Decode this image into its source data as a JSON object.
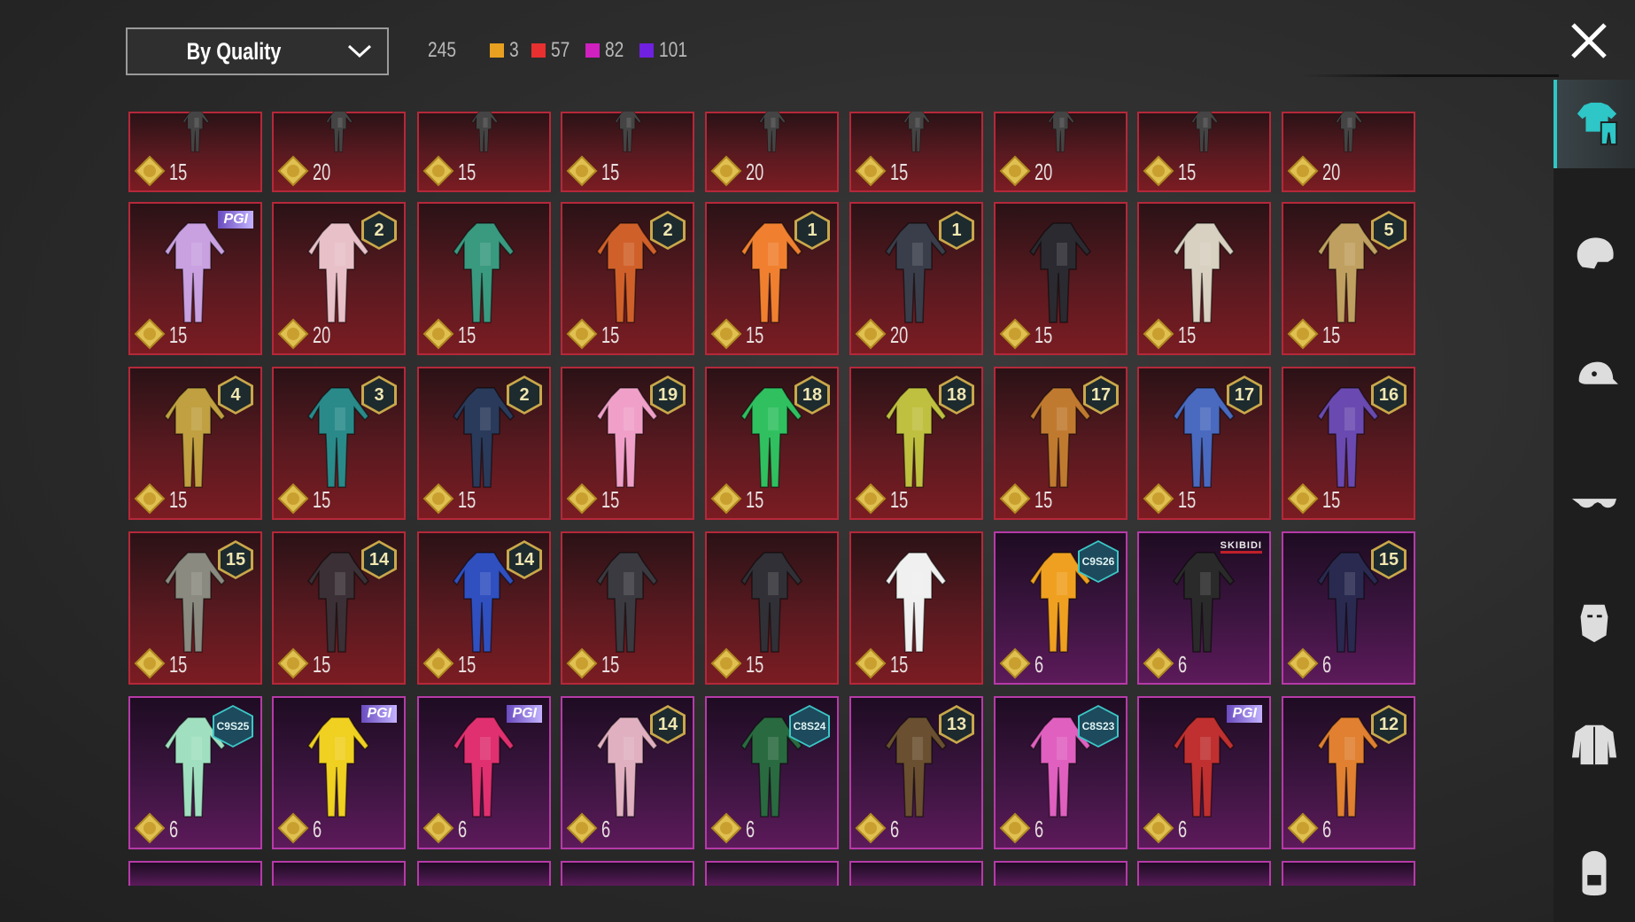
{
  "header": {
    "sort_dropdown": "By Quality",
    "total_count": "245",
    "quality_counts": [
      {
        "quality": "legendary",
        "color": "#e8a020",
        "count": "3"
      },
      {
        "quality": "mythic-red",
        "color": "#e83030",
        "count": "57"
      },
      {
        "quality": "epic-pink",
        "color": "#d020c0",
        "count": "82"
      },
      {
        "quality": "purple",
        "color": "#7020e0",
        "count": "101"
      }
    ]
  },
  "sidebar": {
    "tabs": [
      {
        "name": "outfit",
        "icon": "outfit-icon",
        "active": true
      },
      {
        "name": "helmet",
        "icon": "mask-icon",
        "active": false
      },
      {
        "name": "hat",
        "icon": "cap-icon",
        "active": false
      },
      {
        "name": "glasses",
        "icon": "glasses-icon",
        "active": false
      },
      {
        "name": "face",
        "icon": "face-icon",
        "active": false
      },
      {
        "name": "top",
        "icon": "jacket-icon",
        "active": false
      },
      {
        "name": "backpack",
        "icon": "backpack-icon",
        "active": false
      }
    ]
  },
  "grid": {
    "rows": [
      {
        "partial": "top",
        "items": [
          {
            "quality": "red",
            "value": "15"
          },
          {
            "quality": "red",
            "value": "20"
          },
          {
            "quality": "red",
            "value": "15"
          },
          {
            "quality": "red",
            "value": "15"
          },
          {
            "quality": "red",
            "value": "20"
          },
          {
            "quality": "red",
            "value": "15"
          },
          {
            "quality": "red",
            "value": "20"
          },
          {
            "quality": "red",
            "value": "15"
          },
          {
            "quality": "red",
            "value": "20"
          }
        ]
      },
      {
        "items": [
          {
            "quality": "red",
            "value": "15",
            "badge": "PGI",
            "badge_type": "logo",
            "tint": "#c9a0e0"
          },
          {
            "quality": "red",
            "value": "20",
            "badge": "2",
            "badge_type": "level",
            "tint": "#e8c0c8"
          },
          {
            "quality": "red",
            "value": "15",
            "tint": "#3a9a80"
          },
          {
            "quality": "red",
            "value": "15",
            "badge": "2",
            "badge_type": "level",
            "tint": "#d0602a"
          },
          {
            "quality": "red",
            "value": "15",
            "badge": "1",
            "badge_type": "level",
            "tint": "#f08030"
          },
          {
            "quality": "red",
            "value": "20",
            "badge": "1",
            "badge_type": "level",
            "tint": "#3a3e4a"
          },
          {
            "quality": "red",
            "value": "15",
            "tint": "#2a2a30"
          },
          {
            "quality": "red",
            "value": "15",
            "tint": "#d8d0c0"
          },
          {
            "quality": "red",
            "value": "15",
            "badge": "5",
            "badge_type": "level",
            "tint": "#c0a060"
          }
        ]
      },
      {
        "items": [
          {
            "quality": "red",
            "value": "15",
            "badge": "4",
            "badge_type": "level",
            "tint": "#c0a040"
          },
          {
            "quality": "red",
            "value": "15",
            "badge": "3",
            "badge_type": "level",
            "tint": "#2a8a8a"
          },
          {
            "quality": "red",
            "value": "15",
            "badge": "2",
            "badge_type": "level",
            "tint": "#2a3a5a"
          },
          {
            "quality": "red",
            "value": "15",
            "badge": "19",
            "badge_type": "level",
            "tint": "#f0a0c8"
          },
          {
            "quality": "red",
            "value": "15",
            "badge": "18",
            "badge_type": "level",
            "tint": "#30c060"
          },
          {
            "quality": "red",
            "value": "15",
            "badge": "18",
            "badge_type": "level",
            "tint": "#c0c040"
          },
          {
            "quality": "red",
            "value": "15",
            "badge": "17",
            "badge_type": "level",
            "tint": "#c07a30"
          },
          {
            "quality": "red",
            "value": "15",
            "badge": "17",
            "badge_type": "level",
            "tint": "#4a6ac0"
          },
          {
            "quality": "red",
            "value": "15",
            "badge": "16",
            "badge_type": "level",
            "tint": "#6a4ab0"
          }
        ]
      },
      {
        "items": [
          {
            "quality": "red",
            "value": "15",
            "badge": "15",
            "badge_type": "level",
            "tint": "#8a8a80"
          },
          {
            "quality": "red",
            "value": "15",
            "badge": "14",
            "badge_type": "level",
            "tint": "#3a3035"
          },
          {
            "quality": "red",
            "value": "15",
            "badge": "14",
            "badge_type": "level",
            "tint": "#3050c0"
          },
          {
            "quality": "red",
            "value": "15",
            "tint": "#3a3a40"
          },
          {
            "quality": "red",
            "value": "15",
            "tint": "#303036"
          },
          {
            "quality": "red",
            "value": "15",
            "tint": "#f0f0f0"
          },
          {
            "quality": "purple",
            "value": "6",
            "badge": "C9S26",
            "badge_type": "season",
            "tint": "#f0a020"
          },
          {
            "quality": "purple",
            "value": "6",
            "badge": "SKIBIDI",
            "badge_type": "skibidi",
            "tint": "#2a2a2a"
          },
          {
            "quality": "purple",
            "value": "6",
            "badge": "15",
            "badge_type": "level",
            "tint": "#2a2a50"
          }
        ]
      },
      {
        "items": [
          {
            "quality": "purple",
            "value": "6",
            "badge": "C9S25",
            "badge_type": "season",
            "tint": "#a0e0c0"
          },
          {
            "quality": "purple",
            "value": "6",
            "badge": "PGI",
            "badge_type": "logo",
            "tint": "#f0d020"
          },
          {
            "quality": "purple",
            "value": "6",
            "badge": "PGI",
            "badge_type": "logo",
            "tint": "#e03070"
          },
          {
            "quality": "purple",
            "value": "6",
            "badge": "14",
            "badge_type": "level",
            "tint": "#e0b0c0"
          },
          {
            "quality": "purple",
            "value": "6",
            "badge": "C8S24",
            "badge_type": "season",
            "tint": "#2a6a40"
          },
          {
            "quality": "purple",
            "value": "6",
            "badge": "13",
            "badge_type": "level",
            "tint": "#6a5030"
          },
          {
            "quality": "purple",
            "value": "6",
            "badge": "C8S23",
            "badge_type": "season",
            "tint": "#e060c0"
          },
          {
            "quality": "purple",
            "value": "6",
            "badge": "PGI",
            "badge_type": "logo",
            "tint": "#c03030"
          },
          {
            "quality": "purple",
            "value": "6",
            "badge": "12",
            "badge_type": "level",
            "tint": "#e08030"
          }
        ]
      },
      {
        "partial": "bottom",
        "items": [
          {
            "quality": "purple"
          },
          {
            "quality": "purple"
          },
          {
            "quality": "purple"
          },
          {
            "quality": "purple"
          },
          {
            "quality": "purple"
          },
          {
            "quality": "purple"
          },
          {
            "quality": "purple"
          },
          {
            "quality": "purple"
          },
          {
            "quality": "purple"
          }
        ]
      }
    ]
  }
}
